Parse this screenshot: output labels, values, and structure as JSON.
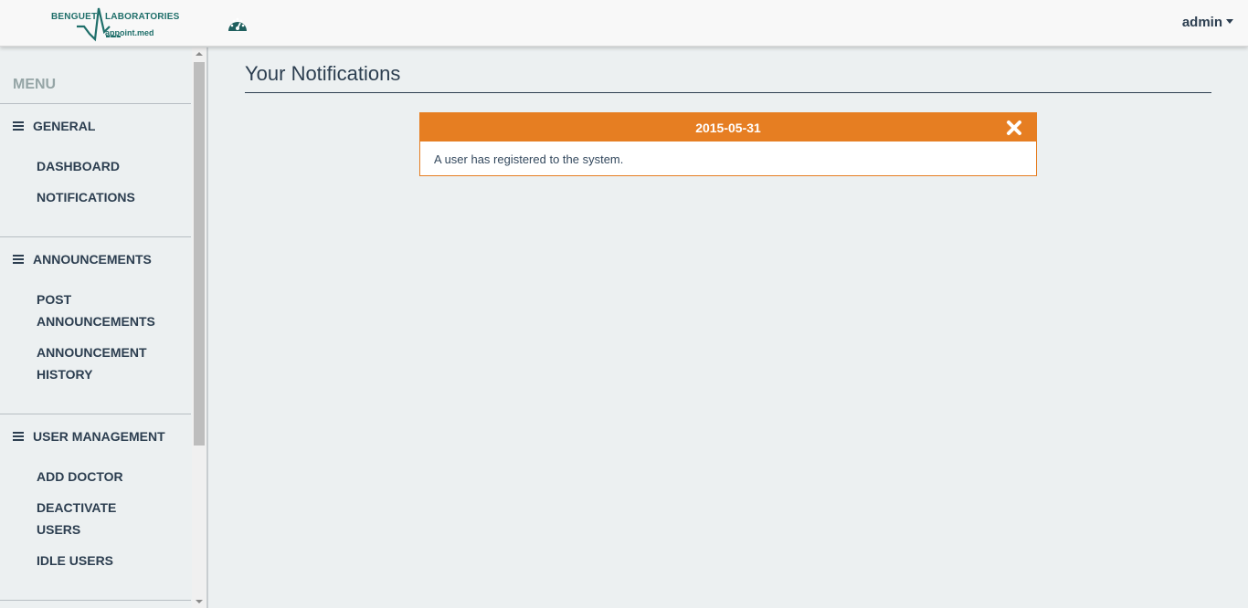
{
  "brand": {
    "left": "BENGUET",
    "right": "LABORATORIES",
    "sub": "appoint.med"
  },
  "icons": {
    "dashboard": "dashboard-gauge-icon",
    "menu_bars": "bars-icon",
    "close": "close-x-icon",
    "caret": "caret-down-icon"
  },
  "user": {
    "name": "admin"
  },
  "sidebar": {
    "title": "MENU",
    "sections": [
      {
        "label": "GENERAL",
        "items": [
          "DASHBOARD",
          "NOTIFICATIONS"
        ]
      },
      {
        "label": "ANNOUNCEMENTS",
        "items": [
          "POST ANNOUNCEMENTS",
          "ANNOUNCEMENT HISTORY"
        ]
      },
      {
        "label": "USER MANAGEMENT",
        "items": [
          "ADD DOCTOR",
          "DEACTIVATE USERS",
          "IDLE USERS"
        ]
      }
    ]
  },
  "main": {
    "title": "Your Notifications",
    "notifications": [
      {
        "date": "2015-05-31",
        "message": "A user has registered to the system."
      }
    ]
  },
  "colors": {
    "accent": "#e67e22",
    "text": "#2c3e50",
    "background": "#ecf0f1",
    "brand": "#1f6f6a"
  }
}
